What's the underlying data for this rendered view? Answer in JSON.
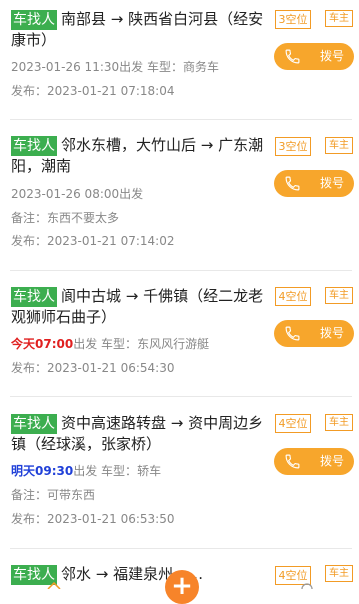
{
  "cards": [
    {
      "type_tag": "车找人",
      "route": "南部县 → 陕西省白河县（经安康市）",
      "seats": "3空位",
      "role": "车主",
      "call_label": "拨号",
      "depart_prefix": "",
      "depart_time": "2023-01-26 11:30",
      "depart_suffix": "出发",
      "car_label": "车型：",
      "car_model": "商务车",
      "note_label": "",
      "note": "",
      "publish_label": "发布：",
      "publish_time": "2023-01-21 07:18:04"
    },
    {
      "type_tag": "车找人",
      "route": "邻水东槽，大竹山后 → 广东潮阳，潮南",
      "seats": "3空位",
      "role": "车主",
      "call_label": "拨号",
      "depart_prefix": "",
      "depart_time": "2023-01-26 08:00",
      "depart_suffix": "出发",
      "car_label": "",
      "car_model": "",
      "note_label": "备注：",
      "note": "东西不要太多",
      "publish_label": "发布：",
      "publish_time": "2023-01-21 07:14:02"
    },
    {
      "type_tag": "车找人",
      "route": "阆中古城 → 千佛镇（经二龙老观狮师石曲子）",
      "seats": "4空位",
      "role": "车主",
      "call_label": "拨号",
      "depart_prefix": "今天07:00",
      "depart_time": "",
      "depart_suffix": "出发",
      "car_label": "车型：",
      "car_model": "东风风行游艇",
      "note_label": "",
      "note": "",
      "publish_label": "发布：",
      "publish_time": "2023-01-21 06:54:30"
    },
    {
      "type_tag": "车找人",
      "route": "资中高速路转盘 → 资中周边乡镇（经球溪，张家桥）",
      "seats": "4空位",
      "role": "车主",
      "call_label": "拨号",
      "depart_prefix": "明天09:30",
      "depart_time": "",
      "depart_suffix": "出发",
      "car_label": "车型：",
      "car_model": "轿车",
      "note_label": "备注：",
      "note": "可带东西",
      "publish_label": "发布：",
      "publish_time": "2023-01-21 06:53:50"
    },
    {
      "type_tag": "车找人",
      "route": "邻水 → 福建泉州……",
      "seats": "4空位",
      "role": "车主"
    }
  ],
  "fab": {
    "label": "+"
  },
  "colors": {
    "accent": "#f7a62c",
    "tag_green": "#3cae4f",
    "today_red": "#e02020",
    "tomorrow_blue": "#2040d8"
  },
  "icons": {
    "call": "phone-icon",
    "nav_home": "home-icon",
    "nav_search": "search-icon"
  }
}
